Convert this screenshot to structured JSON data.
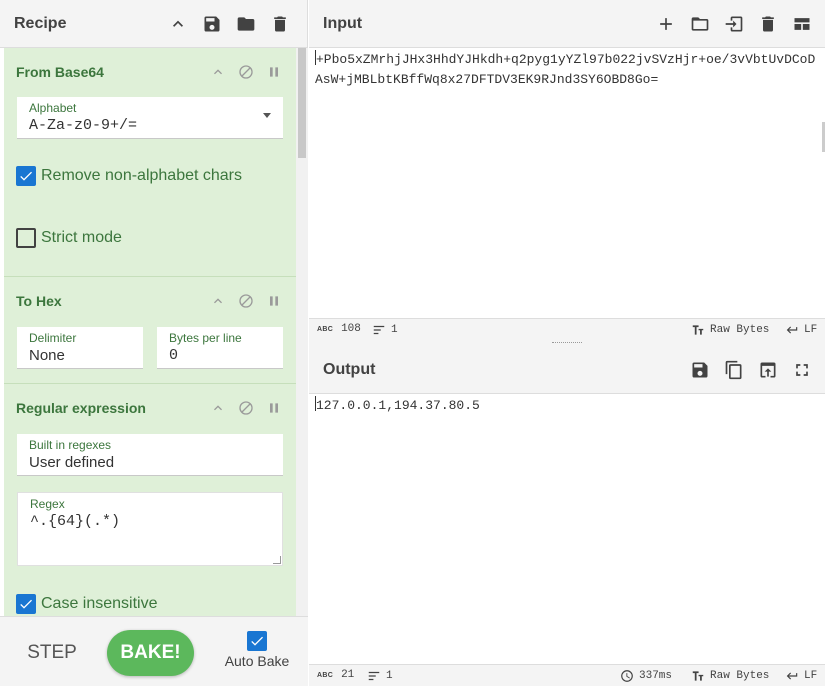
{
  "recipe": {
    "title": "Recipe",
    "icons": [
      "chevron-up-icon",
      "save-icon",
      "folder-icon",
      "trash-icon"
    ],
    "operations": {
      "from_base64": {
        "name": "From Base64",
        "alphabet_label": "Alphabet",
        "alphabet_value": "A-Za-z0-9+/=",
        "remove_non_alphabet": {
          "label": "Remove non-alphabet chars",
          "checked": true
        },
        "strict_mode": {
          "label": "Strict mode",
          "checked": false
        }
      },
      "to_hex": {
        "name": "To Hex",
        "delimiter_label": "Delimiter",
        "delimiter_value": "None",
        "bytes_label": "Bytes per line",
        "bytes_value": "0"
      },
      "regex": {
        "name": "Regular expression",
        "builtin_label": "Built in regexes",
        "builtin_value": "User defined",
        "regex_label": "Regex",
        "regex_value": "^.{64}(.*)",
        "case_insensitive": {
          "label": "Case insensitive",
          "checked": true
        }
      }
    }
  },
  "controls": {
    "step_label": "STEP",
    "bake_label": "BAKE!",
    "autobake_label": "Auto Bake",
    "autobake_checked": true
  },
  "input": {
    "title": "Input",
    "text": "+Pbo5xZMrhjJHx3HhdYJHkdh+q2pyg1yYZl97b022jvSVzHjr+oe/3vVbtUvDCoDAsW+jMBLbtKBffWq8x27DFTDV3EK9RJnd3SY6OBD8Go=",
    "status": {
      "abc_label": "ABC",
      "length": "108",
      "lines": "1",
      "encoding": "Raw Bytes",
      "eol": "LF"
    }
  },
  "output": {
    "title": "Output",
    "text": "127.0.0.1,194.37.80.5",
    "status": {
      "abc_label": "ABC",
      "length": "21",
      "lines": "1",
      "time": "337ms",
      "encoding": "Raw Bytes",
      "eol": "LF"
    }
  },
  "colors": {
    "recipe_bg": "#dff0d8",
    "op_title": "#3c763d",
    "bake_button": "#5cb85c",
    "checkbox": "#1976d2"
  }
}
